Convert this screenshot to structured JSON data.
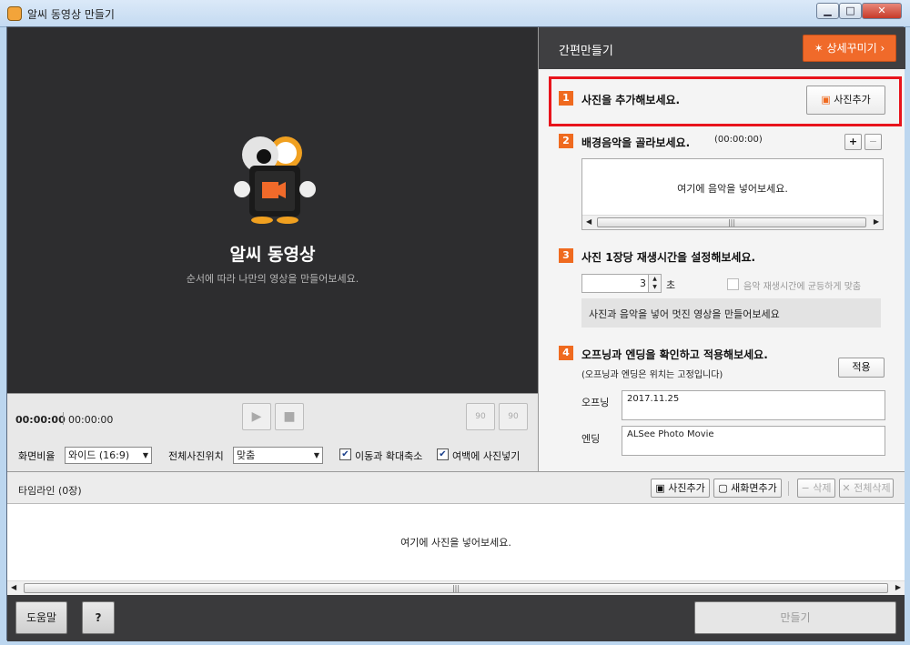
{
  "window": {
    "title": "알씨 동영상 만들기",
    "min": "▁",
    "max": "□",
    "close": "✕"
  },
  "preview": {
    "title": "알씨 동영상",
    "subtitle": "순서에 따라 나만의 영상을 만들어보세요."
  },
  "controls": {
    "time_current": "00:00:00",
    "time_total": "00:00:00",
    "play": "▶",
    "stop": "■",
    "rotate_left": "90",
    "rotate_right": "90",
    "ratio_label": "화면비율",
    "ratio_value": "와이드 (16:9)",
    "position_label": "전체사진위치",
    "position_value": "맞춤",
    "move_zoom": "이동과 확대축소",
    "fill_margin": "여백에 사진넣기"
  },
  "side": {
    "title": "간편만들기",
    "detail_button": "상세꾸미기",
    "step1": {
      "num": "1",
      "title": "사진을 추가해보세요.",
      "button": "사진추가"
    },
    "step2": {
      "num": "2",
      "title": "배경음악을 골라보세요.",
      "duration": "(00:00:00)",
      "add": "+",
      "remove": "−",
      "placeholder": "여기에 음악을 넣어보세요."
    },
    "step3": {
      "num": "3",
      "title": "사진 1장당 재생시간을 설정해보세요.",
      "seconds": "3",
      "unit": "초",
      "sync_label": "음악 재생시간에 균등하게 맞춤",
      "hint": "사진과 음악을 넣어 멋진 영상을 만들어보세요"
    },
    "step4": {
      "num": "4",
      "title": "오프닝과 엔딩을 확인하고 적용해보세요.",
      "note": "(오프닝과 엔딩은 위치는 고정입니다)",
      "apply": "적용",
      "opening_label": "오프닝",
      "opening_value": "2017.11.25",
      "ending_label": "엔딩",
      "ending_value": "ALSee Photo Movie"
    }
  },
  "timeline": {
    "title": "타임라인 (0장)",
    "add_photo": "사진추가",
    "add_new_screen": "새화면추가",
    "delete": "삭제",
    "delete_all": "전체삭제",
    "placeholder": "여기에 사진을 넣어보세요."
  },
  "bottom": {
    "help": "도움말",
    "question": "?",
    "make": "만들기"
  },
  "colors": {
    "accent": "#ef6a1f",
    "highlight": "#e8141c",
    "dark": "#2d2d2f"
  }
}
